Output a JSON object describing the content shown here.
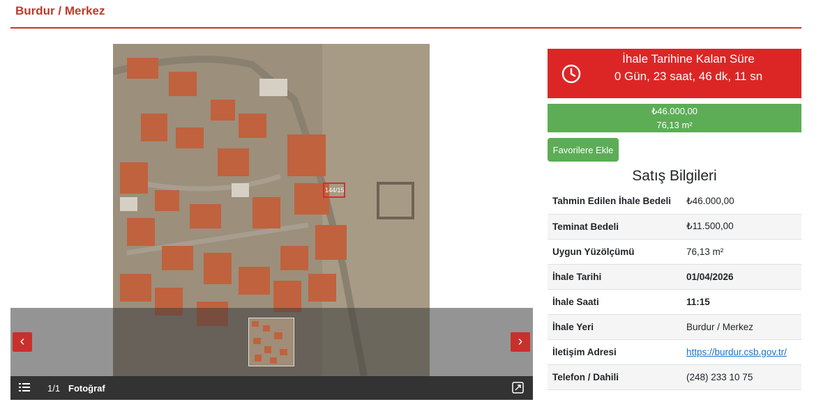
{
  "header": {
    "title": "Burdur / Merkez"
  },
  "gallery": {
    "counter": "1/1",
    "label": "Fotoğraf",
    "photo_street_label": "144/15",
    "prev_icon": "‹",
    "next_icon": "›"
  },
  "countdown": {
    "title": "İhale Tarihine Kalan Süre",
    "time": "0 Gün, 23 saat, 46 dk, 11 sn"
  },
  "summary": {
    "price": "₺46.000,00",
    "area": "76,13 m²"
  },
  "favorite_button": "Favorilere Ekle",
  "sales": {
    "heading": "Satış Bilgileri",
    "rows": [
      {
        "key": "Tahmin Edilen İhale Bedeli",
        "value": "₺46.000,00"
      },
      {
        "key": "Teminat Bedeli",
        "value": "₺11.500,00"
      },
      {
        "key": "Uygun Yüzölçümü",
        "value": "76,13 m²"
      },
      {
        "key": "İhale Tarihi",
        "value": "01/04/2026"
      },
      {
        "key": "İhale Saati",
        "value": "11:15"
      },
      {
        "key": "İhale Yeri",
        "value": "Burdur / Merkez"
      },
      {
        "key": "İletişim Adresi",
        "value": "https://burdur.csb.gov.tr/"
      },
      {
        "key": "Telefon / Dahili",
        "value": "(248) 233 10 75"
      }
    ]
  },
  "colors": {
    "accent": "#c0392b",
    "countdown_bg": "#dc2626",
    "success": "#5cad56",
    "link": "#1a73c8"
  }
}
